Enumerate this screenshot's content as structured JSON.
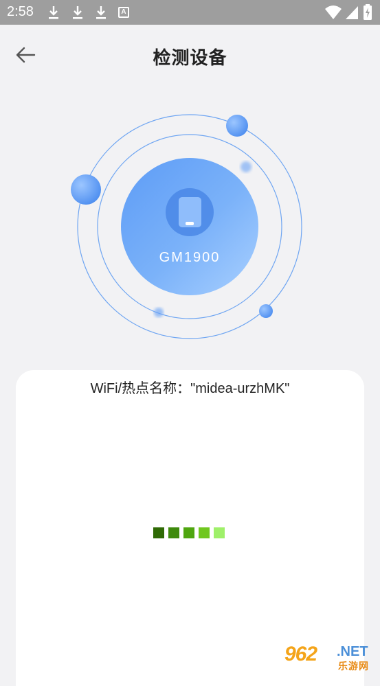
{
  "status_bar": {
    "time": "2:58",
    "icons": [
      "download-icon",
      "download-icon",
      "download-icon",
      "a-notification-icon",
      "wifi-icon",
      "signal-icon",
      "battery-charging-icon"
    ]
  },
  "header": {
    "title": "检测设备",
    "back_icon": "arrow-left-icon"
  },
  "device": {
    "name": "GM1900",
    "icon": "phone-icon"
  },
  "panel": {
    "wifi_text": "WiFi/热点名称：\"midea-urzhMK\""
  },
  "loader": {
    "colors": [
      "#2f6a05",
      "#3e8a0c",
      "#4fa610",
      "#70c71f",
      "#9ff06a"
    ]
  },
  "watermark": {
    "main": "962",
    "suffix": ".NET",
    "sub": "乐游网"
  },
  "colors": {
    "accent_blue": "#5b9bf5",
    "background": "#f2f2f4",
    "status_bar": "#9e9e9e"
  }
}
